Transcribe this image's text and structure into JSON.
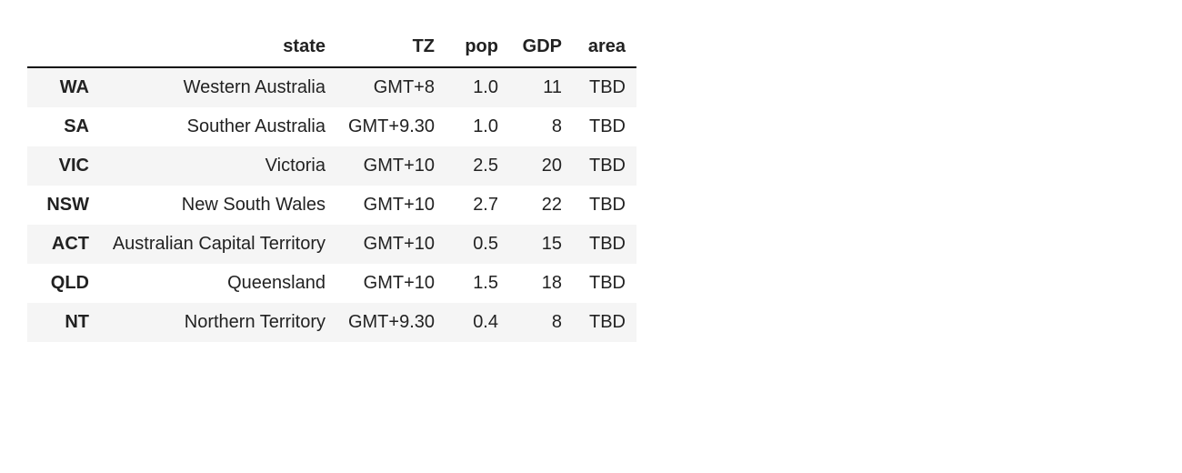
{
  "chart_data": {
    "type": "table",
    "columns": [
      "state",
      "TZ",
      "pop",
      "GDP",
      "area"
    ],
    "index": [
      "WA",
      "SA",
      "VIC",
      "NSW",
      "ACT",
      "QLD",
      "NT"
    ],
    "rows": [
      {
        "state": "Western Australia",
        "TZ": "GMT+8",
        "pop": "1.0",
        "GDP": "11",
        "area": "TBD"
      },
      {
        "state": "Souther Australia",
        "TZ": "GMT+9.30",
        "pop": "1.0",
        "GDP": "8",
        "area": "TBD"
      },
      {
        "state": "Victoria",
        "TZ": "GMT+10",
        "pop": "2.5",
        "GDP": "20",
        "area": "TBD"
      },
      {
        "state": "New South Wales",
        "TZ": "GMT+10",
        "pop": "2.7",
        "GDP": "22",
        "area": "TBD"
      },
      {
        "state": "Australian Capital Territory",
        "TZ": "GMT+10",
        "pop": "0.5",
        "GDP": "15",
        "area": "TBD"
      },
      {
        "state": "Queensland",
        "TZ": "GMT+10",
        "pop": "1.5",
        "GDP": "18",
        "area": "TBD"
      },
      {
        "state": "Northern Territory",
        "TZ": "GMT+9.30",
        "pop": "0.4",
        "GDP": "8",
        "area": "TBD"
      }
    ]
  }
}
